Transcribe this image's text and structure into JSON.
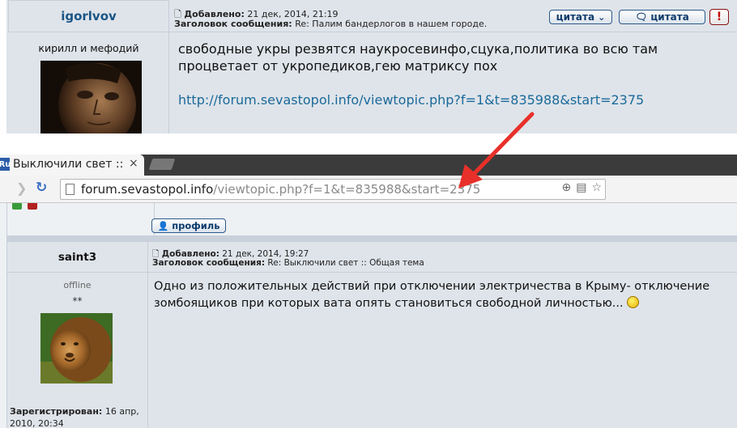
{
  "top_post": {
    "username": "igorlvov",
    "rank": "кирилл и мефодий",
    "posted_label": "Добавлено:",
    "posted_value": "21 дек, 2014, 21:19",
    "subject_label": "Заголовок сообщения:",
    "subject_value": "Re: Палим бандерлогов в нашем городе.",
    "quote_button": "цитата",
    "quote_button_2": "цитата",
    "report_button": "!",
    "body_line_1": "свободные укры резвятся наукросевинфо,сцука,политика во всю там",
    "body_line_2": "процветает от укропедиков,гею матриксу пох",
    "link": "http://forum.sevastopol.info/viewtopic.php?f=1&t=835988&start=2375"
  },
  "browser": {
    "tab_favicon": "Ru",
    "tab_title": "Выключили свет :: О",
    "tab_close": "×",
    "url_host": "forum.sevastopol.info",
    "url_path": "/viewtopic.php?f=1&t=835988&start=2375"
  },
  "bottom_strip": {
    "profile_button": "профиль"
  },
  "bottom_post": {
    "username": "saint3",
    "status": "offline",
    "stars": "**",
    "posted_label": "Добавлено:",
    "posted_value": "21 дек, 2014, 19:27",
    "subject_label": "Заголовок сообщения:",
    "subject_value": "Re: Выключили свет :: Общая тема",
    "body_line_1": "Одно из положительных действий при отключении электричества в Крыму- отключение",
    "body_line_2": "зомбоящиков при которых вата опять становиться свободной личностью...",
    "registered_label": "Зарегистрирован:",
    "registered_value": "16 апр, 2010, 20:34"
  },
  "colors": {
    "post_bg": "#dfe4ea",
    "username_blue": "#1a5585",
    "link_blue": "#1b6a9a",
    "arrow_red": "#e8302a",
    "tabbar_dark": "#3b3b3b"
  }
}
